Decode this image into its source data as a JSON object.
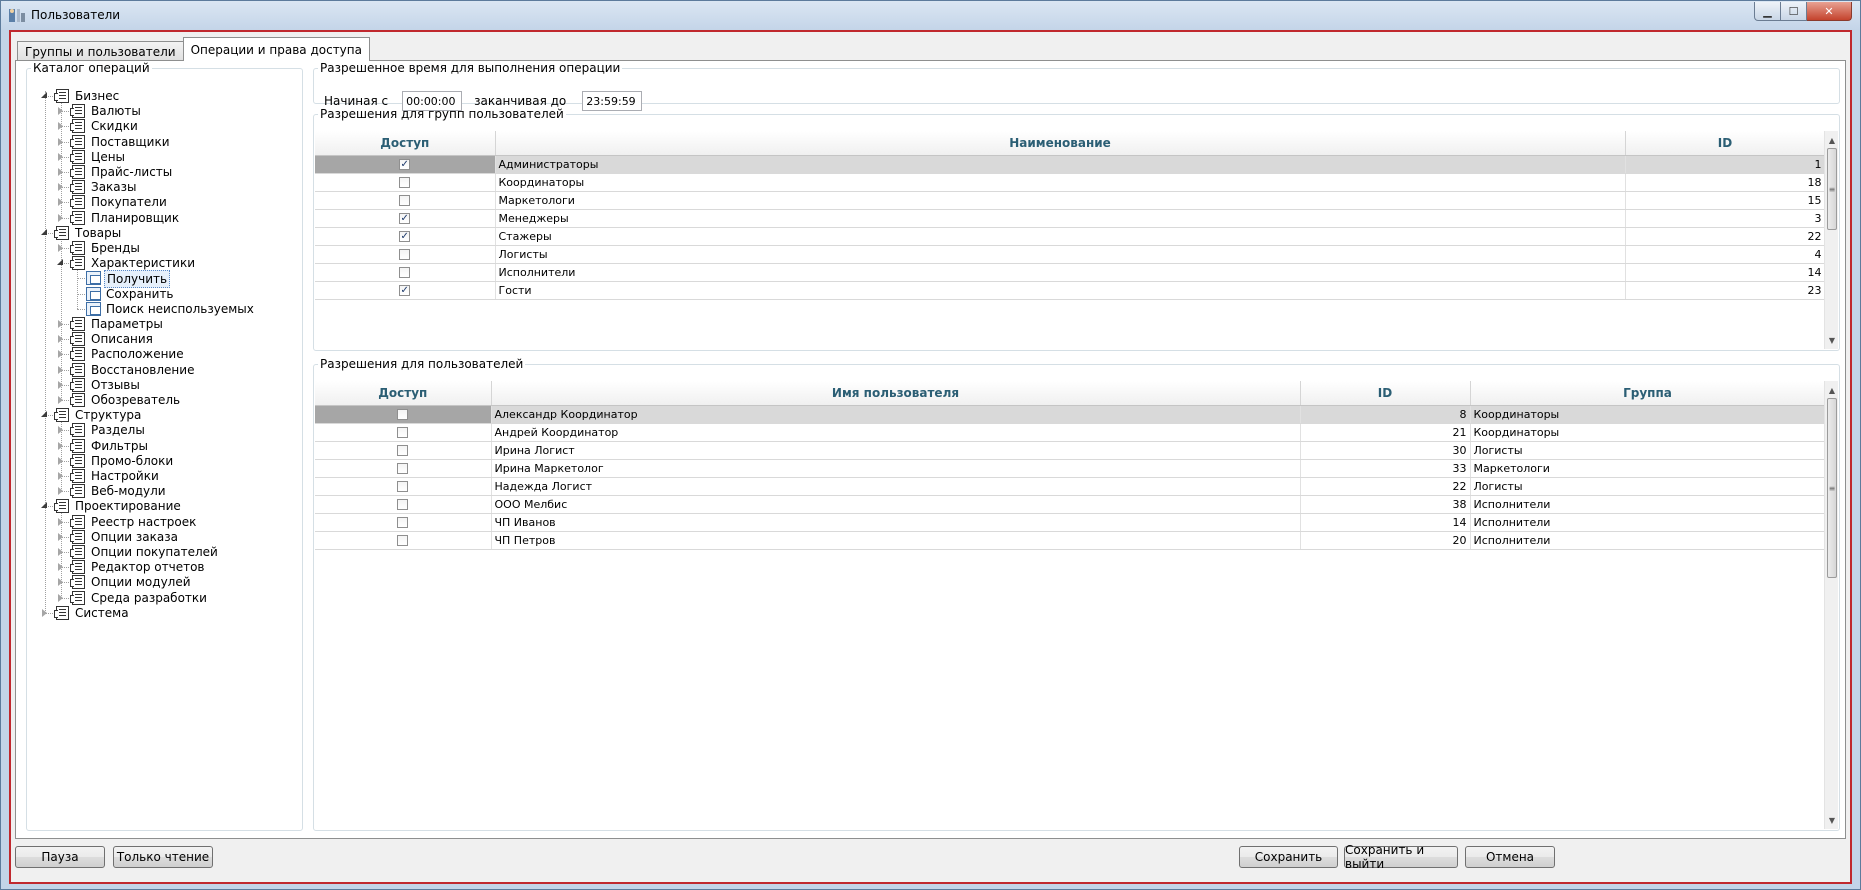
{
  "window": {
    "title": "Пользователи",
    "minimize_glyph": "▁",
    "maximize_glyph": "☐",
    "close_glyph": "✕"
  },
  "tabs": [
    {
      "label": "Группы и пользователи"
    },
    {
      "label": "Операции и права доступа"
    }
  ],
  "tree": {
    "title": "Каталог операций",
    "nodes": [
      {
        "label": "Бизнес",
        "level": 0,
        "expanded": true,
        "type": "folder"
      },
      {
        "label": "Валюты",
        "level": 1,
        "expanded": false,
        "type": "folder"
      },
      {
        "label": "Скидки",
        "level": 1,
        "expanded": false,
        "type": "folder"
      },
      {
        "label": "Поставщики",
        "level": 1,
        "expanded": false,
        "type": "folder"
      },
      {
        "label": "Цены",
        "level": 1,
        "expanded": false,
        "type": "folder"
      },
      {
        "label": "Прайс-листы",
        "level": 1,
        "expanded": false,
        "type": "folder"
      },
      {
        "label": "Заказы",
        "level": 1,
        "expanded": false,
        "type": "folder"
      },
      {
        "label": "Покупатели",
        "level": 1,
        "expanded": false,
        "type": "folder"
      },
      {
        "label": "Планировщик",
        "level": 1,
        "expanded": false,
        "type": "folder"
      },
      {
        "label": "Товары",
        "level": 0,
        "expanded": true,
        "type": "folder"
      },
      {
        "label": "Бренды",
        "level": 1,
        "expanded": false,
        "type": "folder"
      },
      {
        "label": "Характеристики",
        "level": 1,
        "expanded": true,
        "type": "folder"
      },
      {
        "label": "Получить",
        "level": 2,
        "type": "operation",
        "selected": true
      },
      {
        "label": "Сохранить",
        "level": 2,
        "type": "operation"
      },
      {
        "label": "Поиск неиспользуемых",
        "level": 2,
        "type": "operation"
      },
      {
        "label": "Параметры",
        "level": 1,
        "expanded": false,
        "type": "folder"
      },
      {
        "label": "Описания",
        "level": 1,
        "expanded": false,
        "type": "folder"
      },
      {
        "label": "Расположение",
        "level": 1,
        "expanded": false,
        "type": "folder"
      },
      {
        "label": "Восстановление",
        "level": 1,
        "expanded": false,
        "type": "folder"
      },
      {
        "label": "Отзывы",
        "level": 1,
        "expanded": false,
        "type": "folder"
      },
      {
        "label": "Обозреватель",
        "level": 1,
        "expanded": false,
        "type": "folder"
      },
      {
        "label": "Структура",
        "level": 0,
        "expanded": true,
        "type": "folder"
      },
      {
        "label": "Разделы",
        "level": 1,
        "expanded": false,
        "type": "folder"
      },
      {
        "label": "Фильтры",
        "level": 1,
        "expanded": false,
        "type": "folder"
      },
      {
        "label": "Промо-блоки",
        "level": 1,
        "expanded": false,
        "type": "folder"
      },
      {
        "label": "Настройки",
        "level": 1,
        "expanded": false,
        "type": "folder"
      },
      {
        "label": "Веб-модули",
        "level": 1,
        "expanded": false,
        "type": "folder"
      },
      {
        "label": "Проектирование",
        "level": 0,
        "expanded": true,
        "type": "folder"
      },
      {
        "label": "Реестр настроек",
        "level": 1,
        "expanded": false,
        "type": "folder"
      },
      {
        "label": "Опции заказа",
        "level": 1,
        "expanded": false,
        "type": "folder"
      },
      {
        "label": "Опции покупателей",
        "level": 1,
        "expanded": false,
        "type": "folder"
      },
      {
        "label": "Редактор отчетов",
        "level": 1,
        "expanded": false,
        "type": "folder"
      },
      {
        "label": "Опции модулей",
        "level": 1,
        "expanded": false,
        "type": "folder"
      },
      {
        "label": "Среда разработки",
        "level": 1,
        "expanded": false,
        "type": "folder"
      },
      {
        "label": "Система",
        "level": 0,
        "expanded": false,
        "type": "folder"
      }
    ]
  },
  "time": {
    "title": "Разрешенное время для выполнения операции",
    "start_label": "Начиная с",
    "start_value": "00:00:00",
    "end_label": "заканчивая до",
    "end_value": "23:59:59"
  },
  "groups": {
    "title": "Разрешения для групп пользователей",
    "columns": [
      "Доступ",
      "Наименование",
      "ID"
    ],
    "rows": [
      {
        "access": true,
        "name": "Администраторы",
        "id": "1",
        "selected": true
      },
      {
        "access": false,
        "name": "Координаторы",
        "id": "18"
      },
      {
        "access": false,
        "name": "Маркетологи",
        "id": "15"
      },
      {
        "access": true,
        "name": "Менеджеры",
        "id": "3"
      },
      {
        "access": true,
        "name": "Стажеры",
        "id": "22"
      },
      {
        "access": false,
        "name": "Логисты",
        "id": "4"
      },
      {
        "access": false,
        "name": "Исполнители",
        "id": "14"
      },
      {
        "access": true,
        "name": "Гости",
        "id": "23"
      }
    ]
  },
  "users": {
    "title": "Разрешения для пользователей",
    "columns": [
      "Доступ",
      "Имя пользователя",
      "ID",
      "Группа"
    ],
    "rows": [
      {
        "access": false,
        "name": "Александр Координатор",
        "id": "8",
        "group": "Координаторы",
        "selected": true
      },
      {
        "access": false,
        "name": "Андрей Координатор",
        "id": "21",
        "group": "Координаторы"
      },
      {
        "access": false,
        "name": "Ирина Логист",
        "id": "30",
        "group": "Логисты"
      },
      {
        "access": false,
        "name": "Ирина Маркетолог",
        "id": "33",
        "group": "Маркетологи"
      },
      {
        "access": false,
        "name": "Надежда Логист",
        "id": "22",
        "group": "Логисты"
      },
      {
        "access": false,
        "name": "ООО Мелбис",
        "id": "38",
        "group": "Исполнители"
      },
      {
        "access": false,
        "name": "ЧП Иванов",
        "id": "14",
        "group": "Исполнители"
      },
      {
        "access": false,
        "name": "ЧП Петров",
        "id": "20",
        "group": "Исполнители"
      }
    ]
  },
  "buttons": {
    "pause": "Пауза",
    "readonly": "Только чтение",
    "save": "Сохранить",
    "save_exit": "Сохранить и выйти",
    "cancel": "Отмена"
  },
  "colors": {
    "accent_border": "#c0282e",
    "header_text": "#2b5e74",
    "selected_row": "#d9d9d9"
  }
}
